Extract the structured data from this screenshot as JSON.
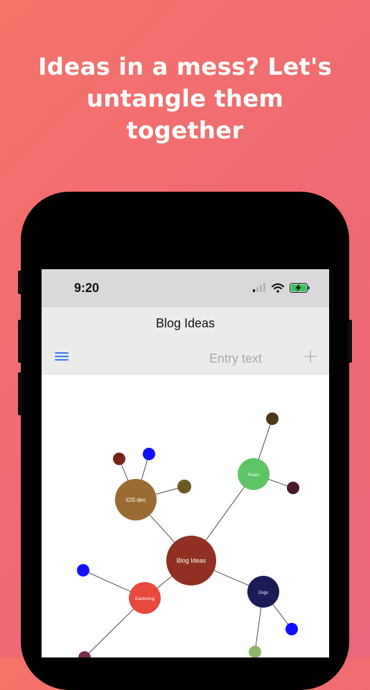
{
  "headline": "Ideas in a mess? Let's\nuntangle them\ntogether",
  "status": {
    "time": "9:20",
    "icons": [
      "signal-icon",
      "wifi-icon",
      "battery-charging-icon"
    ]
  },
  "nav": {
    "title": "Blog Ideas"
  },
  "toolbar": {
    "menu_icon": "hamburger-icon",
    "entry_placeholder": "Entry text",
    "add_icon": "plus-icon"
  },
  "colors": {
    "background_start": "#f4736a",
    "background_end": "#e8677a",
    "accent": "#3478f6",
    "status_bar": "#d9d9db",
    "nav_bar": "#ebebeb"
  },
  "mindmap": {
    "nodes": [
      {
        "id": "root",
        "label": "Blog Ideas",
        "color": "#8f3022"
      },
      {
        "id": "ios",
        "label": "iOS dev",
        "color": "#9a6c33"
      },
      {
        "id": "react",
        "label": "React",
        "color": "#5fc466"
      },
      {
        "id": "dogs",
        "label": "Dogs",
        "color": "#1b1b57"
      },
      {
        "id": "gardening",
        "label": "Gardening",
        "color": "#e8493c"
      },
      {
        "id": "ios_a",
        "label": "",
        "color": "#7a2418"
      },
      {
        "id": "ios_b",
        "label": "",
        "color": "#1010ff"
      },
      {
        "id": "ios_c",
        "label": "",
        "color": "#6d5a22"
      },
      {
        "id": "react_a",
        "label": "",
        "color": "#4d3716"
      },
      {
        "id": "react_b",
        "label": "",
        "color": "#4a1a26"
      },
      {
        "id": "dogs_a",
        "label": "",
        "color": "#1010ff"
      },
      {
        "id": "dogs_b",
        "label": "",
        "color": "#8db56a"
      },
      {
        "id": "garden_a",
        "label": "",
        "color": "#1010ff"
      },
      {
        "id": "garden_b",
        "label": "",
        "color": "#7a2c4f"
      }
    ],
    "edges": [
      [
        "root",
        "ios"
      ],
      [
        "root",
        "react"
      ],
      [
        "root",
        "dogs"
      ],
      [
        "root",
        "gardening"
      ],
      [
        "ios",
        "ios_a"
      ],
      [
        "ios",
        "ios_b"
      ],
      [
        "ios",
        "ios_c"
      ],
      [
        "react",
        "react_a"
      ],
      [
        "react",
        "react_b"
      ],
      [
        "dogs",
        "dogs_a"
      ],
      [
        "dogs",
        "dogs_b"
      ],
      [
        "gardening",
        "garden_a"
      ],
      [
        "gardening",
        "garden_b"
      ]
    ]
  }
}
